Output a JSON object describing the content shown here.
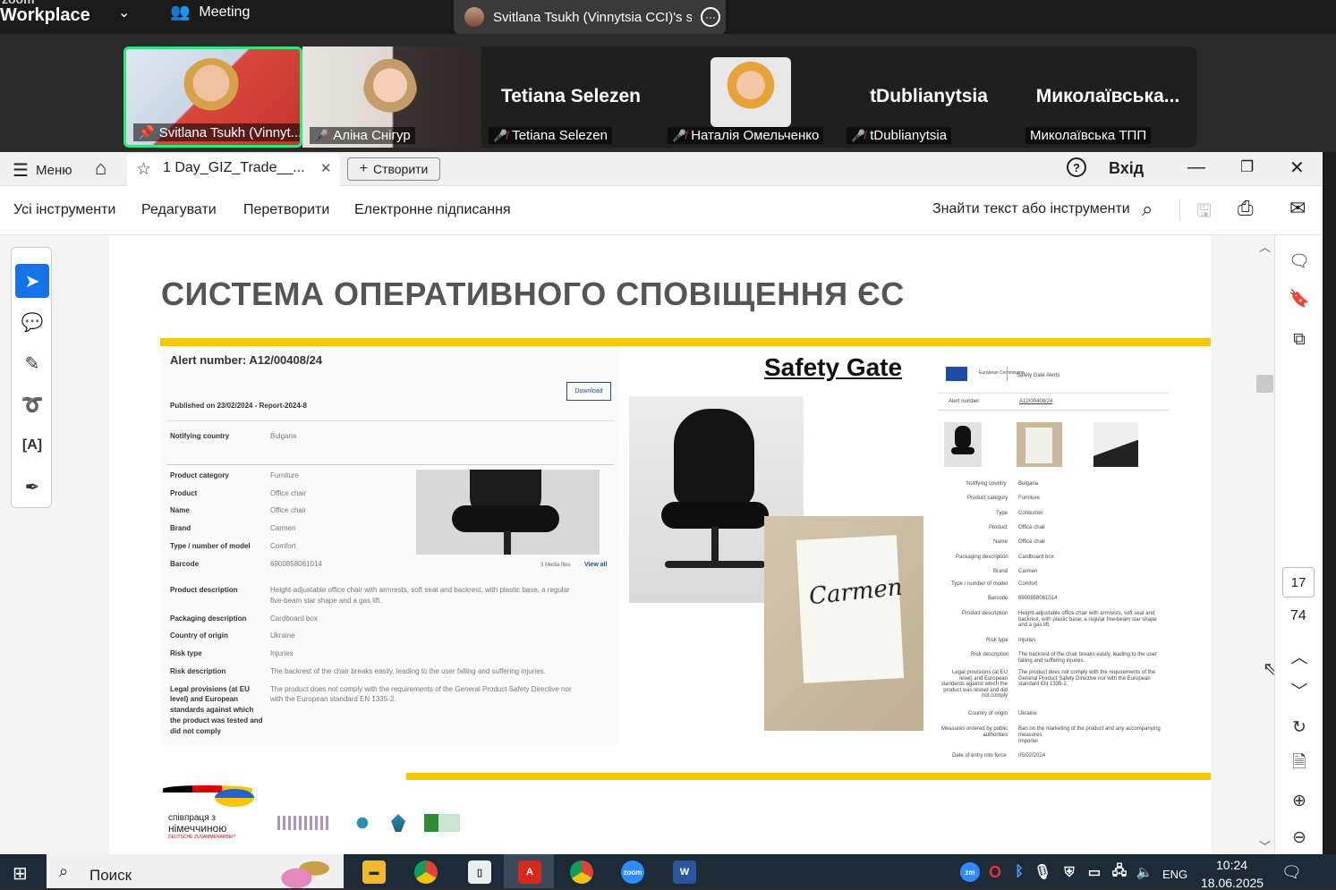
{
  "zoom": {
    "logo_small": "zoom",
    "logo": "Workplace",
    "meeting_label": "Meeting",
    "share_title": "Svitlana Tsukh (Vinnytsia CCI)'s sc",
    "participants": [
      {
        "label": "Svitlana Tsukh (Vinnyt...",
        "big": ""
      },
      {
        "label": "Аліна Снігур",
        "big": ""
      },
      {
        "label": "Tetiana Selezen",
        "big": "Tetiana Selezen"
      },
      {
        "label": "Наталія Омельченко",
        "big": ""
      },
      {
        "label": "tDublianytsia",
        "big": "tDublianytsia"
      },
      {
        "label": "Миколаївська ТПП",
        "big": "Миколаївська..."
      }
    ]
  },
  "acrobat": {
    "menu": "Меню",
    "tab_title": "1 Day_GIZ_Trade__...",
    "create": "Створити",
    "signin": "Вхід",
    "tools": [
      "Усі інструменти",
      "Редагувати",
      "Перетворити",
      "Електронне підписання"
    ],
    "search": "Знайти текст або інструменти",
    "page_current": "17",
    "page_total": "74"
  },
  "slide": {
    "title": "СИСТЕМА ОПЕРАТИВНОГО СПОВІЩЕННЯ ЄС",
    "safety_gate": "Safety Gate",
    "alert": {
      "heading": "Alert number: A12/00408/24",
      "download": "Download",
      "published": "Published on 23/02/2024 - Report-2024-8",
      "media": "3  Media files",
      "view_all": "View all",
      "rows": [
        {
          "k": "Notifying country",
          "v": "Bulgaria"
        },
        {
          "k": "Product category",
          "v": "Furniture"
        },
        {
          "k": "Product",
          "v": "Office chair"
        },
        {
          "k": "Name",
          "v": "Office chair"
        },
        {
          "k": "Brand",
          "v": "Carmen"
        },
        {
          "k": "Type / number of model",
          "v": "Comfort"
        },
        {
          "k": "Barcode",
          "v": "6900858061014"
        },
        {
          "k": "Product description",
          "v": "Height-adjustable office chair with armrests, soft seat and backrest, with plastic base, a regular",
          "v2": "five-beam star shape and a gas lift."
        },
        {
          "k": "Packaging description",
          "v": "Cardboard box"
        },
        {
          "k": "Country of origin",
          "v": "Ukraine"
        },
        {
          "k": "Risk type",
          "v": "Injuries"
        },
        {
          "k": "Risk description",
          "v": "The backrest of the chair breaks easily, leading to the user falling and suffering injuries."
        },
        {
          "k": "Legal provisions (at EU",
          "k2": "level) and European",
          "k3": "standards against which",
          "k4": "the product was tested and",
          "k5": "did not comply",
          "v": "The product does not comply with the requirements of the General Product Safety Directive nor",
          "v2": "with the European standard EN 1335-2."
        }
      ]
    },
    "box_label": "Carmen",
    "right": {
      "ec": "European Commission",
      "sga": "Safety Gate Alerts",
      "alert_k": "Alert number",
      "alert_v": "A12/00408/24",
      "rows": [
        {
          "k": "Notifying country",
          "v": "Bulgaria"
        },
        {
          "k": "Product category",
          "v": "Furniture"
        },
        {
          "k": "Type",
          "v": "Consumer"
        },
        {
          "k": "Product",
          "v": "Office chair"
        },
        {
          "k": "Name",
          "v": "Office chair"
        },
        {
          "k": "Packaging description",
          "v": "Cardboard box"
        },
        {
          "k": "Brand",
          "v": "Carmen"
        },
        {
          "k": "Type / number of model",
          "v": "Comfort"
        },
        {
          "k": "Barcode",
          "v": "6900858061014"
        }
      ],
      "desc_k": "Product description",
      "desc_v": "Height-adjustable office chair with armrests, soft seat and backrest, with plastic base, a regular five-beam star shape and a gas lift.",
      "risk_type_k": "Risk type",
      "risk_type_v": "Injuries",
      "risk_desc_k": "Risk description",
      "risk_desc_v": "The backrest of the chair breaks easily, leading to the user falling and suffering injuries.",
      "legal_k": "Legal provisions (at EU level) and European standards against which the product was tested and did not comply",
      "legal_v": "The product does not comply with the requirements of the General Product Safety Directive nor with the European standard EN 1335-2.",
      "origin_k": "Country of origin",
      "origin_v": "Ukraine",
      "measures_k": "Measures ordered by public authorities",
      "measures_v": "Ban on the marketing of the product and any accompanying measures",
      "measures_v2": "Importer",
      "date_k": "Date of entry into force",
      "date_v": "05/02/2024"
    },
    "footer": {
      "coop1": "співпраця з",
      "coop2": "німеччиною",
      "coop3": "DEUTSCHE ZUSAMMENARBEIT"
    }
  },
  "taskbar": {
    "search": "Поиск",
    "lang": "ENG",
    "time": "10:24",
    "date": "18.06.2025"
  },
  "colors": {
    "accent_yellow": "#f7c600",
    "speaker_green": "#2ee87a",
    "mic_red": "#e0343c"
  }
}
